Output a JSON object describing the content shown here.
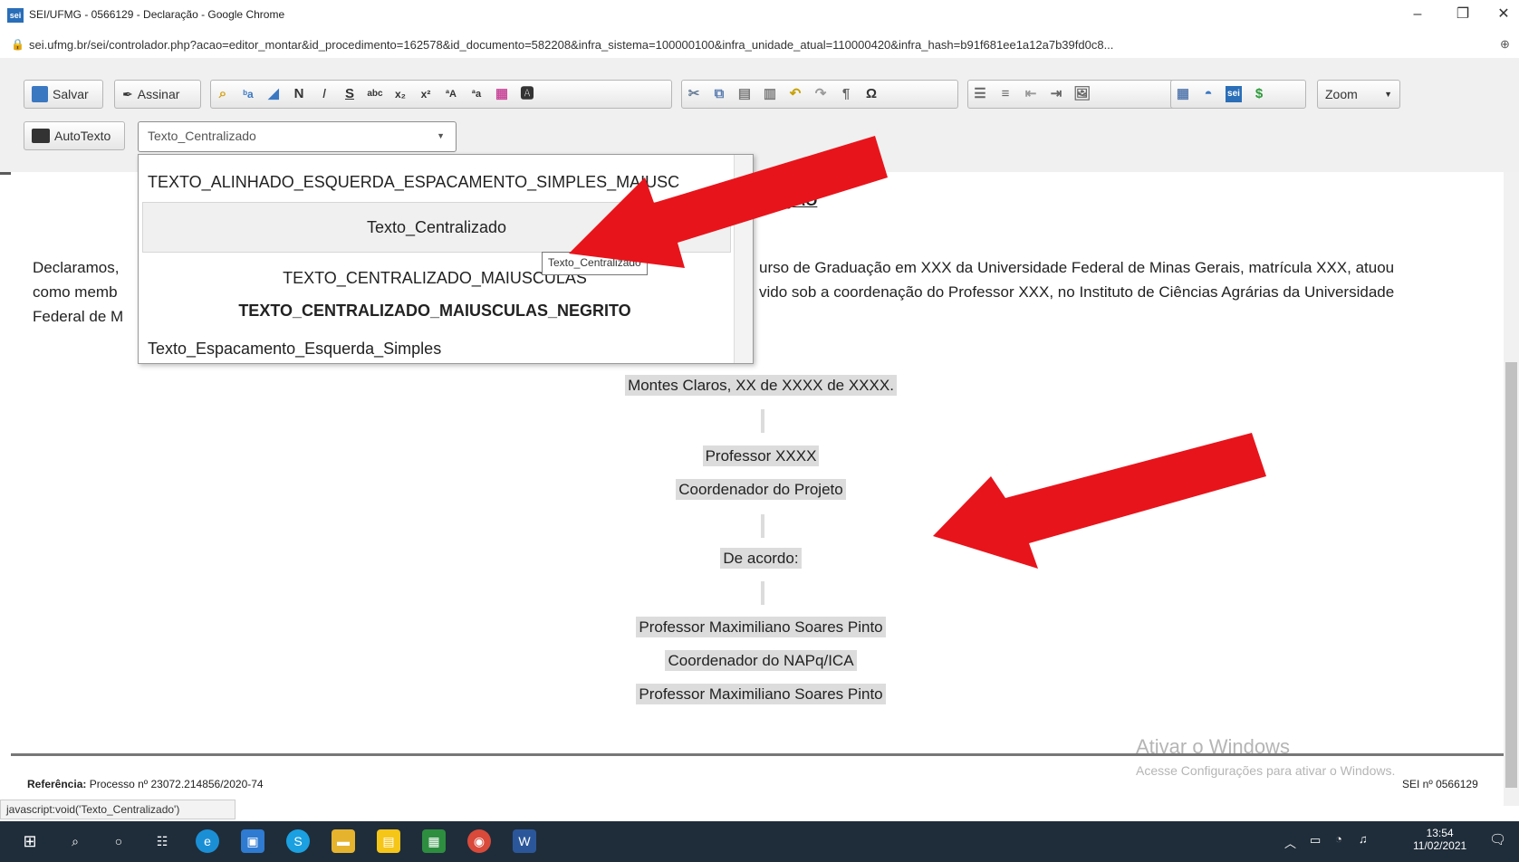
{
  "window": {
    "title": "SEI/UFMG - 0566129 - Declaração - Google Chrome",
    "logo_text": "sei",
    "url": "sei.ufmg.br/sei/controlador.php?acao=editor_montar&id_procedimento=162578&id_documento=582208&infra_sistema=100000100&infra_unidade_atual=110000420&infra_hash=b91f681ee1a12a7b39fd0c8..."
  },
  "toolbar": {
    "save_label": "Salvar",
    "sign_label": "Assinar",
    "zoom_label": "Zoom",
    "autotext_label": "AutoTexto",
    "style_value": "Texto_Centralizado"
  },
  "dropdown": {
    "items": [
      "TEXTO_ALINHADO_ESQUERDA_ESPACAMENTO_SIMPLES_MAIUSC",
      "Texto_Centralizado",
      "TEXTO_CENTRALIZADO_MAIUSCULAS",
      "TEXTO_CENTRALIZADO_MAIUSCULAS_NEGRITO",
      "Texto_Espacamento_Esquerda_Simples"
    ],
    "tooltip": "Texto_Centralizado"
  },
  "document": {
    "heading_fragment": "RAÇÃO",
    "para_line1_left": "Declaramos,",
    "para_line1_right": "urso de Graduação em XXX da Universidade Federal de Minas Gerais, matrícula XXX, atuou",
    "para_line2_left": "como memb",
    "para_line2_right": "vido sob a coordenação do Professor XXX, no Instituto de Ciências Agrárias da Universidade",
    "para_line3_left": "Federal de M",
    "place_date": "Montes Claros, XX de XXXX de XXXX.",
    "signer1": "Professor XXXX",
    "signer1_role": "Coordenador do Projeto",
    "agreement": "De acordo:",
    "signer2": "Professor Maximiliano Soares Pinto",
    "signer2_role": "Coordenador do NAPq/ICA",
    "signer2_repeat": "Professor Maximiliano Soares Pinto"
  },
  "footer": {
    "reference_label": "Referência:",
    "reference_value": "Processo nº 23072.214856/2020-74",
    "sei_number": "SEI nº 0566129",
    "watermark_title": "Ativar o Windows",
    "watermark_sub": "Acesse Configurações para ativar o Windows."
  },
  "status": "javascript:void('Texto_Centralizado')",
  "taskbar": {
    "time": "13:54",
    "date": "11/02/2021"
  },
  "colors": {
    "arrow": "#e8141b",
    "highlight": "#dcdcdc"
  }
}
